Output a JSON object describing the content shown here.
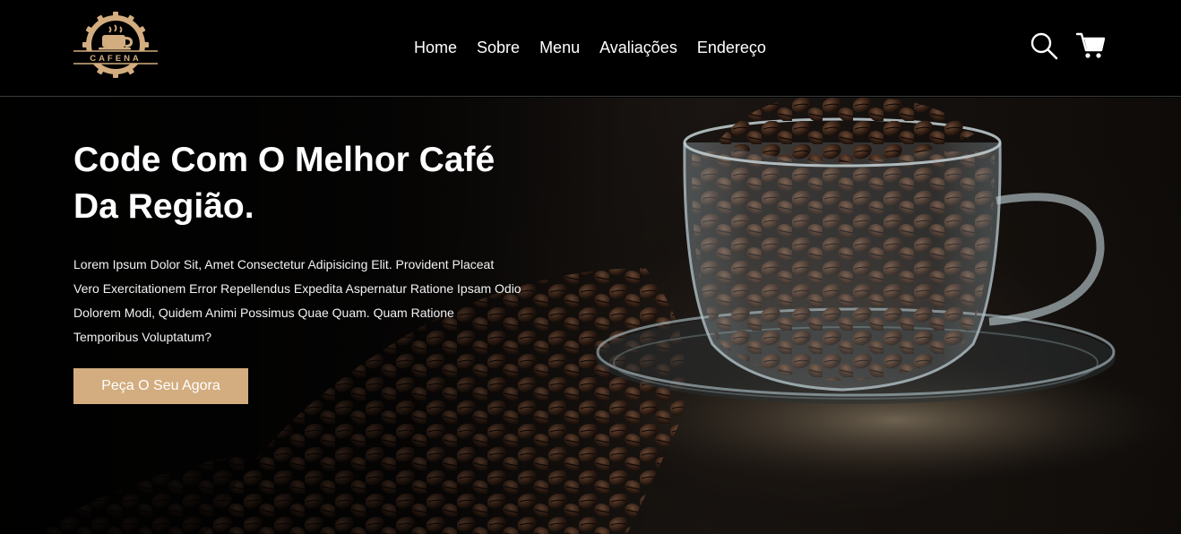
{
  "brand": {
    "name": "CAFENA",
    "accent": "#d3ad7f"
  },
  "nav": {
    "items": [
      {
        "label": "Home"
      },
      {
        "label": "Sobre"
      },
      {
        "label": "Menu"
      },
      {
        "label": "Avaliações"
      },
      {
        "label": "Endereço"
      }
    ]
  },
  "header_icons": {
    "search": "search-icon",
    "cart": "cart-icon"
  },
  "hero": {
    "title_line1": "Code Com O Melhor Café",
    "title_line2": "Da Região.",
    "description": "Lorem Ipsum Dolor Sit, Amet Consectetur Adipisicing Elit. Provident Placeat Vero Exercitationem Error Repellendus Expedita Aspernatur Ratione Ipsam Odio Dolorem Modi, Quidem Animi Possimus Quae Quam. Quam Ratione Temporibus Voluptatum?",
    "cta_label": "Peça O Seu Agora"
  }
}
